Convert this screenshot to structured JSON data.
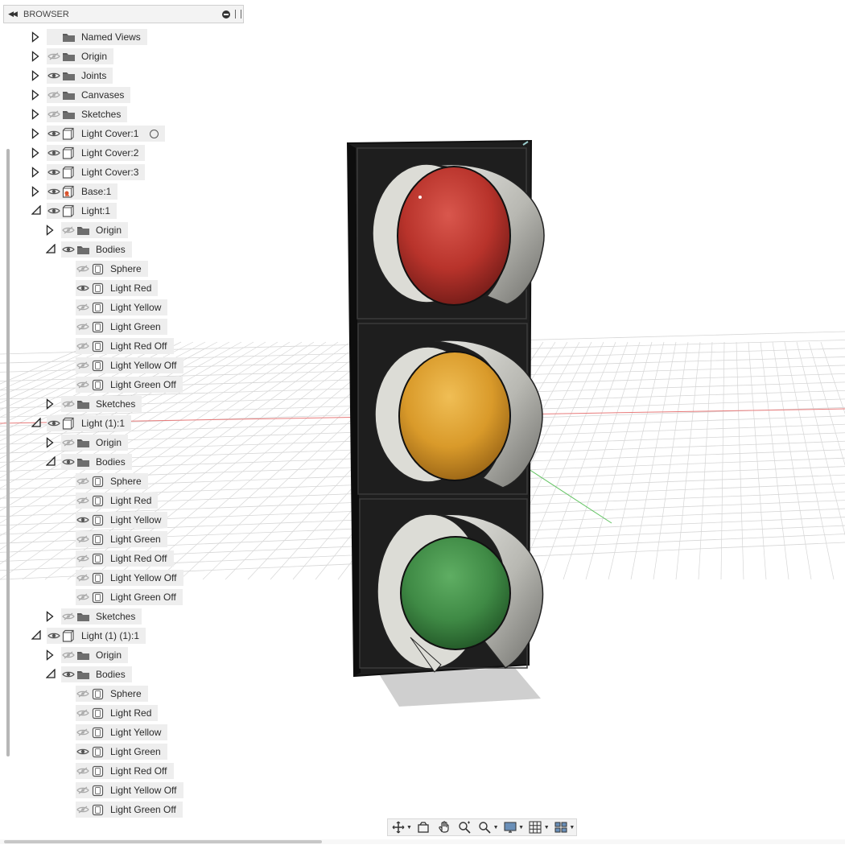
{
  "browser": {
    "title": "BROWSER",
    "items": [
      {
        "label": "Named Views",
        "level": 0,
        "expander": "collapsed",
        "eye": "none",
        "icon": "folder"
      },
      {
        "label": "Origin",
        "level": 0,
        "expander": "collapsed",
        "eye": "hidden",
        "icon": "folder"
      },
      {
        "label": "Joints",
        "level": 0,
        "expander": "collapsed",
        "eye": "visible",
        "icon": "folder"
      },
      {
        "label": "Canvases",
        "level": 0,
        "expander": "collapsed",
        "eye": "hidden",
        "icon": "folder"
      },
      {
        "label": "Sketches",
        "level": 0,
        "expander": "collapsed",
        "eye": "hidden",
        "icon": "folder"
      },
      {
        "label": "Light Cover:1",
        "level": 0,
        "expander": "collapsed",
        "eye": "visible",
        "icon": "component",
        "activate": true
      },
      {
        "label": "Light Cover:2",
        "level": 0,
        "expander": "collapsed",
        "eye": "visible",
        "icon": "component"
      },
      {
        "label": "Light Cover:3",
        "level": 0,
        "expander": "collapsed",
        "eye": "visible",
        "icon": "component"
      },
      {
        "label": "Base:1",
        "level": 0,
        "expander": "collapsed",
        "eye": "visible",
        "icon": "component-base"
      },
      {
        "label": "Light:1",
        "level": 0,
        "expander": "expanded",
        "eye": "visible",
        "icon": "component"
      },
      {
        "label": "Origin",
        "level": 1,
        "expander": "collapsed",
        "eye": "hidden",
        "icon": "folder"
      },
      {
        "label": "Bodies",
        "level": 1,
        "expander": "expanded",
        "eye": "visible",
        "icon": "folder"
      },
      {
        "label": "Sphere",
        "level": 2,
        "expander": "none",
        "eye": "hidden",
        "icon": "body"
      },
      {
        "label": "Light Red",
        "level": 2,
        "expander": "none",
        "eye": "visible",
        "icon": "body"
      },
      {
        "label": "Light Yellow",
        "level": 2,
        "expander": "none",
        "eye": "hidden",
        "icon": "body"
      },
      {
        "label": "Light Green",
        "level": 2,
        "expander": "none",
        "eye": "hidden",
        "icon": "body"
      },
      {
        "label": "Light Red Off",
        "level": 2,
        "expander": "none",
        "eye": "hidden",
        "icon": "body"
      },
      {
        "label": "Light Yellow Off",
        "level": 2,
        "expander": "none",
        "eye": "hidden",
        "icon": "body"
      },
      {
        "label": "Light Green Off",
        "level": 2,
        "expander": "none",
        "eye": "hidden",
        "icon": "body"
      },
      {
        "label": "Sketches",
        "level": 1,
        "expander": "collapsed",
        "eye": "hidden",
        "icon": "folder"
      },
      {
        "label": "Light (1):1",
        "level": 0,
        "expander": "expanded",
        "eye": "visible",
        "icon": "component"
      },
      {
        "label": "Origin",
        "level": 1,
        "expander": "collapsed",
        "eye": "hidden",
        "icon": "folder"
      },
      {
        "label": "Bodies",
        "level": 1,
        "expander": "expanded",
        "eye": "visible",
        "icon": "folder"
      },
      {
        "label": "Sphere",
        "level": 2,
        "expander": "none",
        "eye": "hidden",
        "icon": "body"
      },
      {
        "label": "Light Red",
        "level": 2,
        "expander": "none",
        "eye": "hidden",
        "icon": "body"
      },
      {
        "label": "Light Yellow",
        "level": 2,
        "expander": "none",
        "eye": "visible",
        "icon": "body"
      },
      {
        "label": "Light Green",
        "level": 2,
        "expander": "none",
        "eye": "hidden",
        "icon": "body"
      },
      {
        "label": "Light Red Off",
        "level": 2,
        "expander": "none",
        "eye": "hidden",
        "icon": "body"
      },
      {
        "label": "Light Yellow Off",
        "level": 2,
        "expander": "none",
        "eye": "hidden",
        "icon": "body"
      },
      {
        "label": "Light Green Off",
        "level": 2,
        "expander": "none",
        "eye": "hidden",
        "icon": "body"
      },
      {
        "label": "Sketches",
        "level": 1,
        "expander": "collapsed",
        "eye": "hidden",
        "icon": "folder"
      },
      {
        "label": "Light (1) (1):1",
        "level": 0,
        "expander": "expanded",
        "eye": "visible",
        "icon": "component"
      },
      {
        "label": "Origin",
        "level": 1,
        "expander": "collapsed",
        "eye": "hidden",
        "icon": "folder"
      },
      {
        "label": "Bodies",
        "level": 1,
        "expander": "expanded",
        "eye": "visible",
        "icon": "folder"
      },
      {
        "label": "Sphere",
        "level": 2,
        "expander": "none",
        "eye": "hidden",
        "icon": "body"
      },
      {
        "label": "Light Red",
        "level": 2,
        "expander": "none",
        "eye": "hidden",
        "icon": "body"
      },
      {
        "label": "Light Yellow",
        "level": 2,
        "expander": "none",
        "eye": "hidden",
        "icon": "body"
      },
      {
        "label": "Light Green",
        "level": 2,
        "expander": "none",
        "eye": "visible",
        "icon": "body"
      },
      {
        "label": "Light Red Off",
        "level": 2,
        "expander": "none",
        "eye": "hidden",
        "icon": "body"
      },
      {
        "label": "Light Yellow Off",
        "level": 2,
        "expander": "none",
        "eye": "hidden",
        "icon": "body"
      },
      {
        "label": "Light Green Off",
        "level": 2,
        "expander": "none",
        "eye": "hidden",
        "icon": "body"
      }
    ]
  },
  "viewport": {
    "lights": [
      {
        "name": "red",
        "color": "#b8332b"
      },
      {
        "name": "yellow",
        "color": "#d99a2a"
      },
      {
        "name": "green",
        "color": "#3f8a45"
      }
    ],
    "housing_color": "#1c1c1c",
    "grid_color": "#d6d6d6",
    "axis_colors": {
      "x": "#e87b7b",
      "y": "#63c463"
    }
  },
  "toolbar": {
    "tools": [
      "orbit-icon",
      "look-at-icon",
      "pan-icon",
      "zoom-icon",
      "fit-icon",
      "display-settings-icon",
      "grid-settings-icon",
      "viewports-icon"
    ]
  }
}
